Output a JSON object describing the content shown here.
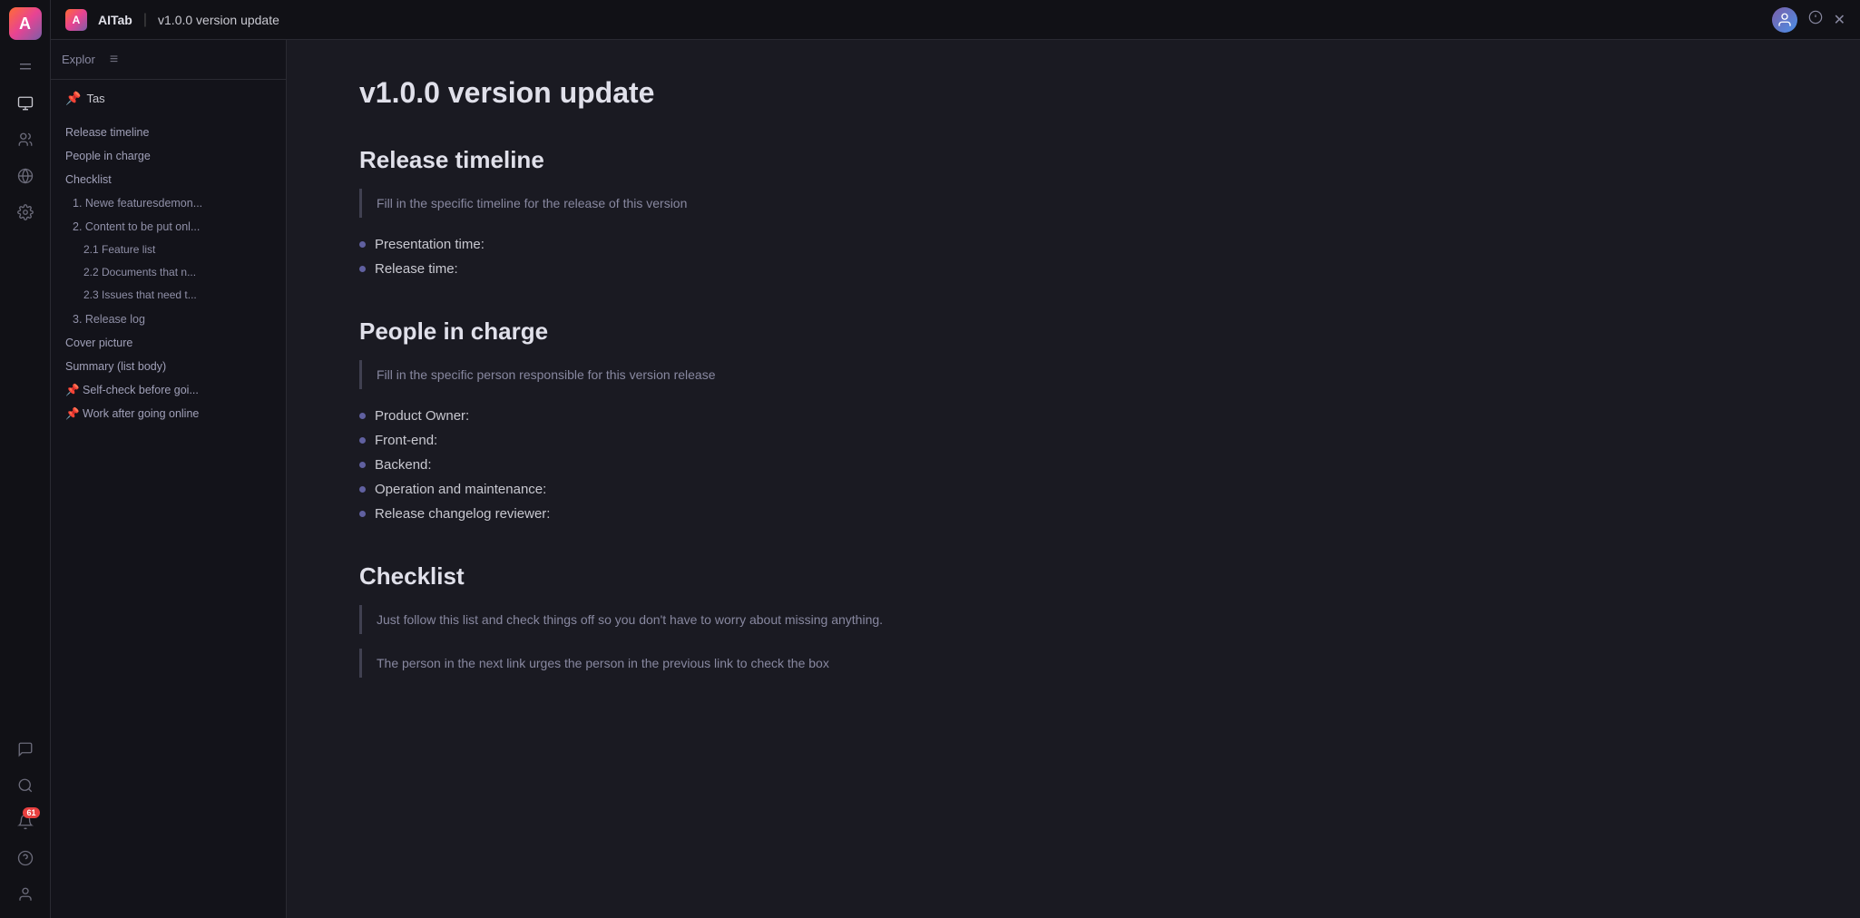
{
  "topBar": {
    "brandName": "AITab",
    "docTitle": "v1.0.0 version update",
    "logoText": "A"
  },
  "sidebar": {
    "exploreLabel": "Explor",
    "pinLabel": "Tas",
    "tocItems": [
      {
        "id": "release-timeline",
        "label": "Release timeline",
        "level": 1
      },
      {
        "id": "people-in-charge",
        "label": "People in charge",
        "level": 1
      },
      {
        "id": "checklist",
        "label": "Checklist",
        "level": 1
      },
      {
        "id": "newe-features",
        "label": "1. Newe featuresdemon...",
        "level": 2
      },
      {
        "id": "content-to-be-put",
        "label": "2. Content to be put onl...",
        "level": 2
      },
      {
        "id": "feature-list",
        "label": "2.1 Feature list",
        "level": 3
      },
      {
        "id": "documents-that",
        "label": "2.2 Documents that n...",
        "level": 3
      },
      {
        "id": "issues-that-need",
        "label": "2.3 Issues that need t...",
        "level": 3
      },
      {
        "id": "release-log",
        "label": "3. Release log",
        "level": 2
      },
      {
        "id": "cover-picture",
        "label": "Cover picture",
        "level": 1
      },
      {
        "id": "summary",
        "label": "Summary (list body)",
        "level": 1
      },
      {
        "id": "self-check",
        "label": "Self-check before goi...",
        "level": 1,
        "pin": true
      },
      {
        "id": "work-after",
        "label": "Work after going online",
        "level": 1,
        "pin": true
      }
    ]
  },
  "document": {
    "mainTitle": "v1.0.0 version update",
    "sections": [
      {
        "id": "release-timeline",
        "heading": "Release timeline",
        "blockquote": "Fill in the specific timeline for the release of this version",
        "bullets": [
          "Presentation time:",
          "Release time:"
        ]
      },
      {
        "id": "people-in-charge",
        "heading": "People in charge",
        "blockquote": "Fill in the specific person responsible for this version release",
        "bullets": [
          "Product Owner:",
          "Front-end:",
          "Backend:",
          "Operation and maintenance:",
          "Release changelog reviewer:"
        ]
      },
      {
        "id": "checklist",
        "heading": "Checklist",
        "blockquote1": "Just follow this list and check things off so you don't have to worry about missing anything.",
        "blockquote2": "The person in the next link urges the person in the previous link to check the box",
        "bullets": []
      }
    ]
  },
  "icons": {
    "monitor": "🖥",
    "users": "👥",
    "globe": "🌐",
    "settings": "⚙",
    "chat": "💬",
    "search": "🔍",
    "bell": "🔔",
    "help": "❓",
    "user": "👤",
    "badgeCount": "61",
    "close": "✕",
    "info": "ℹ"
  }
}
